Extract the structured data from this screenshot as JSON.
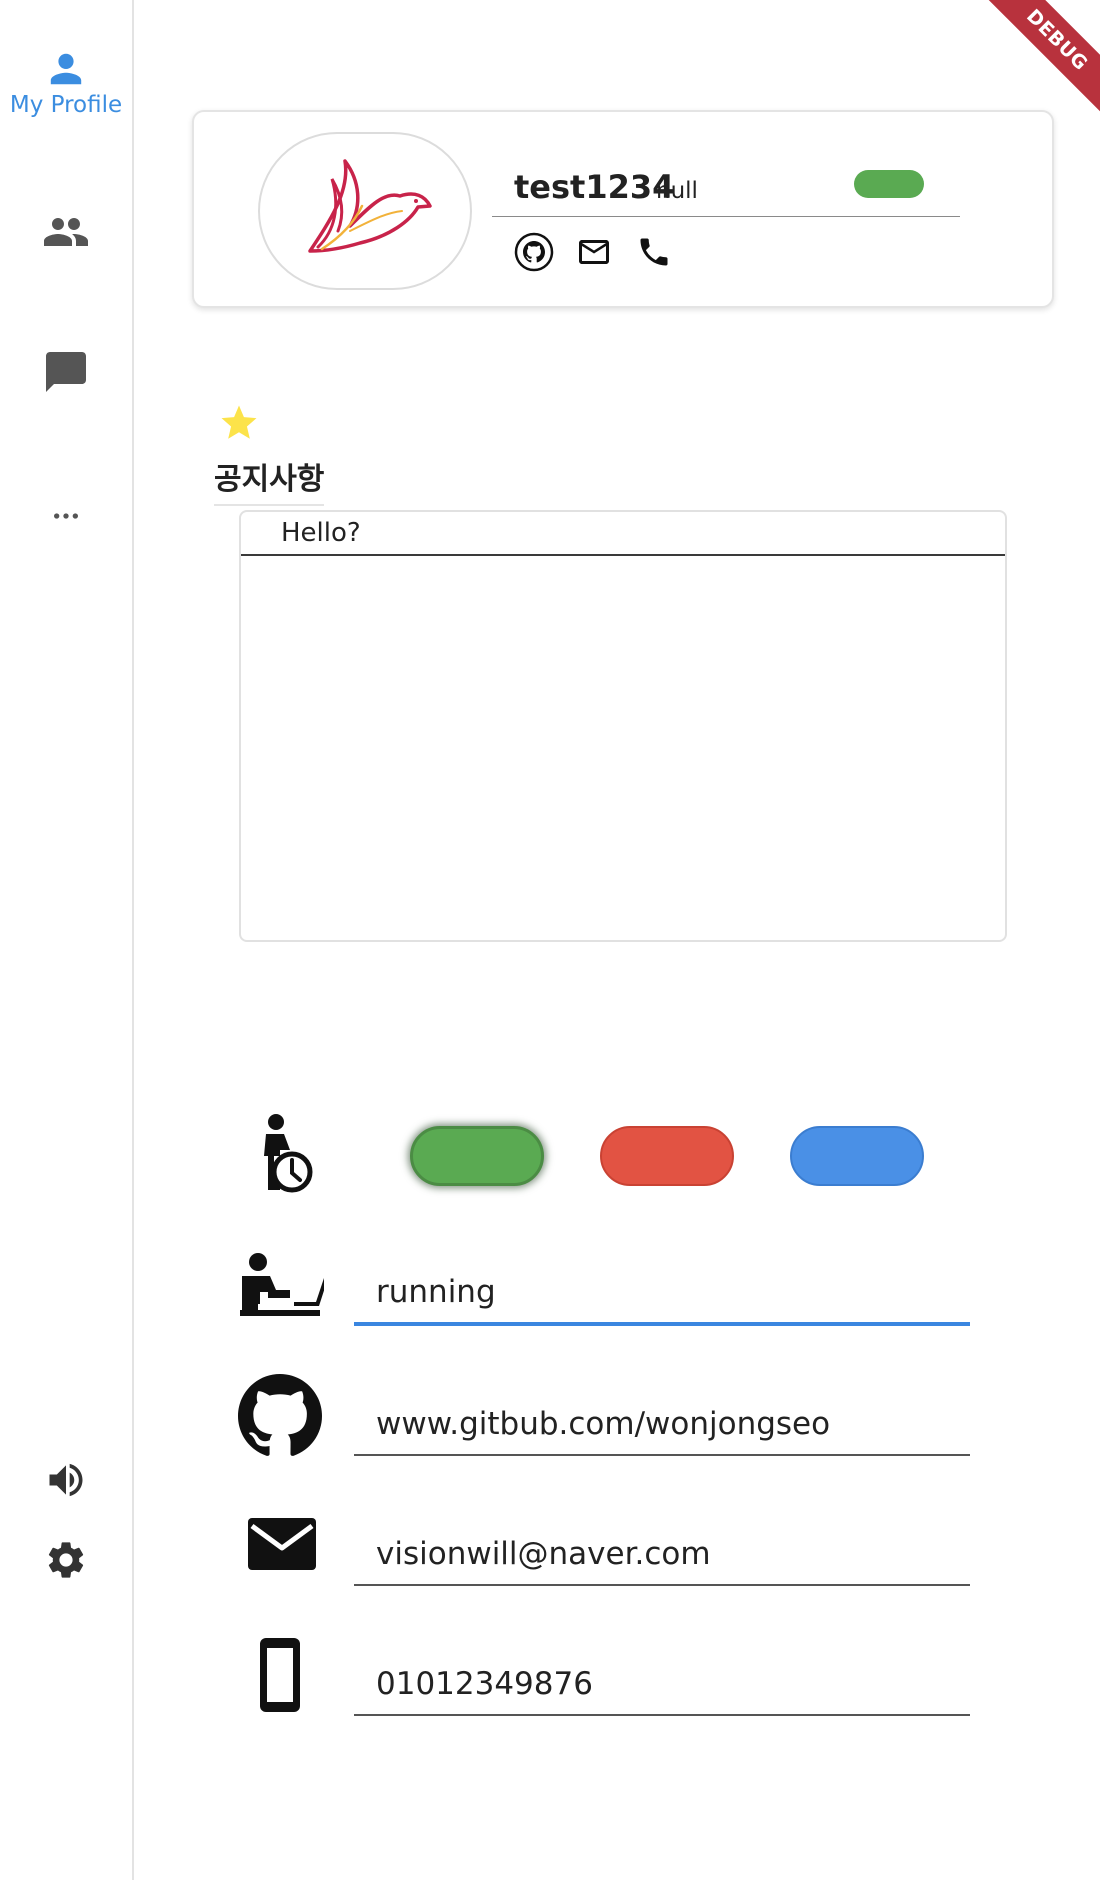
{
  "sidebar": {
    "items": [
      {
        "label": "My Profile",
        "icon": "person-icon",
        "active": true
      },
      {
        "label": "",
        "icon": "people-icon"
      },
      {
        "label": "",
        "icon": "chat-icon"
      },
      {
        "label": "",
        "icon": "more-horizontal-icon"
      },
      {
        "label": "",
        "icon": "volume-icon"
      },
      {
        "label": "",
        "icon": "settings-icon"
      }
    ],
    "accent": "#3b8de0"
  },
  "debug_banner": "DEBUG",
  "profile": {
    "name": "test1234",
    "status": "null",
    "status_color": "#5aaa52",
    "contact_icons": [
      "github-icon",
      "mail-icon",
      "phone-icon"
    ]
  },
  "notice": {
    "title": "공지사항",
    "text": "Hello?",
    "star_color": "#fce34a"
  },
  "status_buttons": [
    {
      "name": "green",
      "color": "#5aaa52",
      "selected": true
    },
    {
      "name": "red",
      "color": "#e25343",
      "selected": false
    },
    {
      "name": "blue",
      "color": "#4a90e6",
      "selected": false
    }
  ],
  "info": {
    "activity": "running",
    "github": "www.gitbub.com/wonjongseo",
    "email": "visionwill@naver.com",
    "phone": "01012349876"
  }
}
